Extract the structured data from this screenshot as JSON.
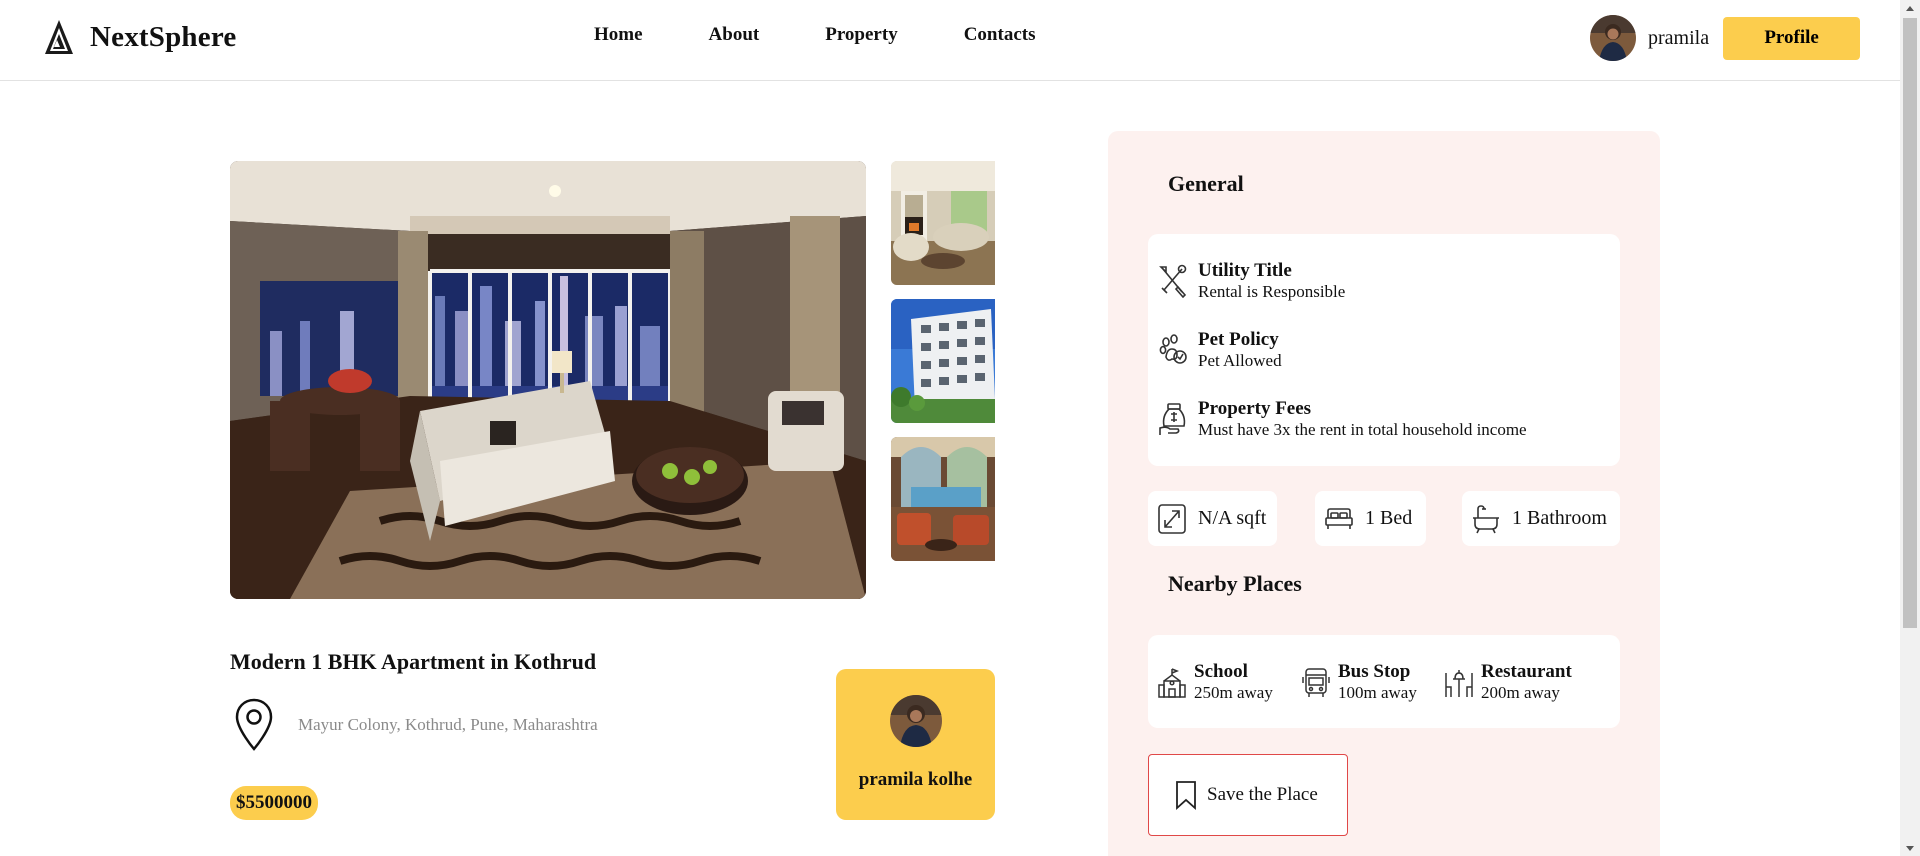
{
  "brand": {
    "name": "NextSphere",
    "logo_icon": "pyramid-logo-icon"
  },
  "nav": {
    "links": [
      "Home",
      "About",
      "Property",
      "Contacts"
    ]
  },
  "user": {
    "name": "pramila",
    "profile_label": "Profile"
  },
  "gallery": {
    "main_alt": "Living room with city view",
    "thumbs": [
      "Living room interior",
      "Apartment building exterior",
      "Lounge with pool view"
    ]
  },
  "listing": {
    "title": "Modern 1 BHK Apartment in Kothrud",
    "location": "Mayur Colony, Kothrud, Pune, Maharashtra",
    "price": "$5500000",
    "owner": "pramila kolhe"
  },
  "general": {
    "title": "General",
    "items": [
      {
        "label": "Utility Title",
        "value": "Rental is Responsible",
        "icon": "tools-icon"
      },
      {
        "label": "Pet Policy",
        "value": "Pet Allowed",
        "icon": "paw-icon"
      },
      {
        "label": "Property Fees",
        "value": "Must have 3x the rent in total household income",
        "icon": "money-bag-icon"
      }
    ]
  },
  "stats": {
    "size": "N/A sqft",
    "beds": "1 Bed",
    "baths": "1 Bathroom"
  },
  "nearby": {
    "title": "Nearby Places",
    "items": [
      {
        "label": "School",
        "value": "250m away",
        "icon": "school-icon"
      },
      {
        "label": "Bus Stop",
        "value": "100m away",
        "icon": "bus-icon"
      },
      {
        "label": "Restaurant",
        "value": "200m away",
        "icon": "restaurant-icon"
      }
    ]
  },
  "save": {
    "label": "Save the Place"
  },
  "colors": {
    "accent": "#fccd4d",
    "panel_bg": "#fdf1ef",
    "save_border": "#e04848"
  }
}
